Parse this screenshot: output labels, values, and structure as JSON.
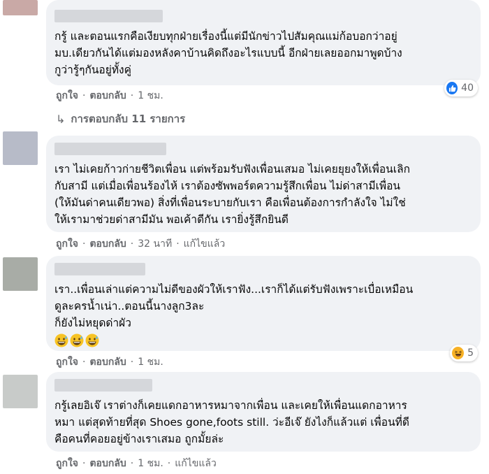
{
  "comments": [
    {
      "text": "กรู้ และตอนแรกคือเงียบทุกฝ่ายเรื่องนี้แต่มีนักข่าวไปสัมคุณแม่ก้อบอกว่าอยู่\nมบ.เดียวกันได้แต่มองหลังคาบ้านคิดถึงอะไรแบบนี้ อีกฝ่ายเลยออกมาพูดบ้าง\nกูว่ารู้ๆกันอยู่ทั้งคู่",
      "like_label": "ถูกใจ",
      "reply_label": "ตอบกลับ",
      "time": "1 ชม.",
      "reaction_count": "40",
      "reaction_icon": "like-icon",
      "replies_label": "การตอบกลับ 11 รายการ"
    },
    {
      "text": "เรา ไม่เคยก้าวก่ายชีวิตเพื่อน แต่พร้อมรับฟังเพื่อนเสมอ ไม่เคยยุยงให้เพื่อนเลิก\nกับสามี แต่เมื่อเพื่อนร้องไห้ เราต้องซัพพอร์ตความรู้สึกเพื่อน ไม่ด่าสามีเพื่อน\n(ให้มันด่าคนเดียวพอ) สิ่งที่เพื่อนระบายกับเรา คือเพื่อนต้องการกำลังใจ ไม่ใช่\nให้เรามาช่วยด่าสามีมัน พอเค้าดีกัน เรายิ่งรู้สึกยินดี",
      "like_label": "ถูกใจ",
      "reply_label": "ตอบกลับ",
      "time": "32 นาที",
      "edited": "แก้ไขแล้ว"
    },
    {
      "text": "เรา..เพื่อนเล่าแต่ความไม่ดีของผัวให้เราฟัง...เราก็ได้แต่รับฟังเพราะเบื่อเหมือน\nดูละครน้ำเน่า..ตอนนี้นางลูก3ละ\nก็ยังไม่หยุดด่าผัว",
      "emojis": [
        "grinning-sweat-emoji",
        "grinning-sweat-emoji",
        "grinning-sweat-emoji"
      ],
      "like_label": "ถูกใจ",
      "reply_label": "ตอบกลับ",
      "time": "1 ชม.",
      "reaction_count": "5",
      "reaction_icon": "haha-icon"
    },
    {
      "text": "กรู้เลยอิเจ๊ เราต่างก็เคยแดกอาหารหมาจากเพื่อน และเคยให้เพื่อนแดกอาหาร\nหมา แต่สุดท้ายที่สุด Shoes gone,foots still. ว่ะอีเจ๊ ยังไงก็แล้วแต่ เพื่อนที่ดี\nคือคนที่คอยอยู่ข้างเราเสมอ ถูกมั้ยล่ะ",
      "like_label": "ถูกใจ",
      "reply_label": "ตอบกลับ",
      "time": "1 ชม.",
      "edited": "แก้ไขแล้ว"
    }
  ],
  "colors": {
    "bubble": "#f0f2f5",
    "meta_text": "#65676b",
    "like_blue": "#1877f2",
    "haha_yellow": "#f7b125"
  }
}
